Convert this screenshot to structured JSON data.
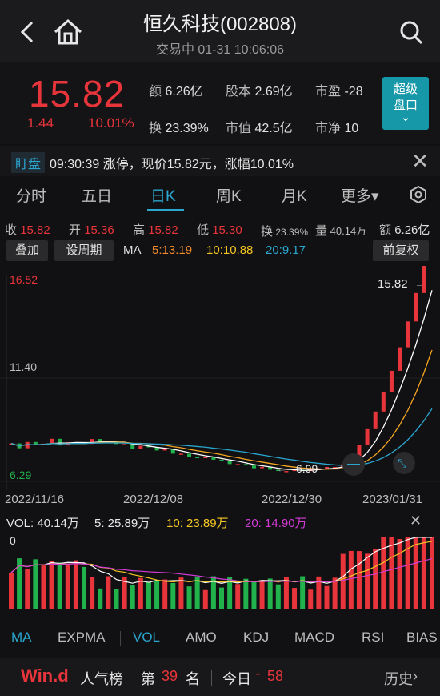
{
  "header": {
    "title": "恒久科技(002808)",
    "subtitle": "交易中 01-31 10:06:06"
  },
  "quote": {
    "price": "15.82",
    "change": "1.44",
    "change_pct": "10.01%",
    "fields": [
      {
        "label": "额",
        "value": "6.26亿"
      },
      {
        "label": "股本",
        "value": "2.69亿"
      },
      {
        "label": "市盈",
        "value": "-28"
      },
      {
        "label": "换",
        "value": "23.39%"
      },
      {
        "label": "市值",
        "value": "42.5亿"
      },
      {
        "label": "市净",
        "value": "10"
      }
    ],
    "badge_line1": "超级",
    "badge_line2": "盘口",
    "badge_arrow": "⌄"
  },
  "ticker": {
    "tag": "盯盘",
    "message": "09:30:39 涨停，现价15.82元，涨幅10.01%",
    "close": "✕"
  },
  "tabs": [
    {
      "label": "分时"
    },
    {
      "label": "五日"
    },
    {
      "label": "日K"
    },
    {
      "label": "周K"
    },
    {
      "label": "月K"
    },
    {
      "label": "更多▾"
    }
  ],
  "stats": [
    {
      "label": "收",
      "value": "15.82"
    },
    {
      "label": "开",
      "value": "15.36"
    },
    {
      "label": "高",
      "value": "15.82"
    },
    {
      "label": "低",
      "value": "15.30"
    },
    {
      "label": "换",
      "value": "23.39%"
    },
    {
      "label": "量",
      "value": "40.14万"
    },
    {
      "label": "额",
      "value": "6.26亿"
    }
  ],
  "toolbar": {
    "overlay": "叠加",
    "period": "设周期",
    "ma_label": "MA",
    "ma5": "5:13.19",
    "ma10": "10:10.88",
    "ma20": "20:9.17",
    "adjust": "前复权"
  },
  "chart_data": {
    "type": "candlestick",
    "y_ticks": [
      "16.52",
      "11.40",
      "6.29"
    ],
    "ylim": [
      6.29,
      16.52
    ],
    "x_ticks": [
      "2022/11/16",
      "2022/12/08",
      "2022/12/30",
      "2023/01/31"
    ],
    "last_price_label": "15.82",
    "low_marker": "6.99",
    "colors": {
      "up": "#e8353b",
      "down": "#22b24c",
      "ma5": "#ffffff",
      "ma10": "#f5a623",
      "ma20": "#2aa6cf"
    }
  },
  "volume": {
    "vol_label": "VOL: 40.14万",
    "ma5": "5: 25.89万",
    "ma10": "10: 23.89万",
    "ma20": "20: 14.90万",
    "zero": "0",
    "close": "✕"
  },
  "indicators": [
    {
      "label": "MA"
    },
    {
      "label": "EXPMA"
    },
    {
      "label": "VOL"
    },
    {
      "label": "AMO"
    },
    {
      "label": "KDJ"
    },
    {
      "label": "MACD"
    },
    {
      "label": "RSI"
    },
    {
      "label": "BIAS"
    }
  ],
  "rank": {
    "brand": "Win.d",
    "label": "人气榜",
    "prefix": "第",
    "number": "39",
    "suffix": "名",
    "today": "今日",
    "today_change": "58",
    "history": "历史"
  }
}
